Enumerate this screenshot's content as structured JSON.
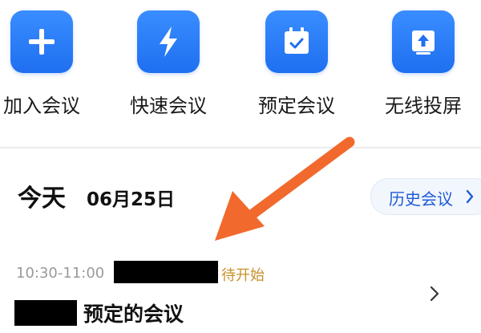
{
  "actions": [
    {
      "label": "加入会议",
      "icon": "plus-icon"
    },
    {
      "label": "快速会议",
      "icon": "lightning-icon"
    },
    {
      "label": "预定会议",
      "icon": "calendar-check-icon"
    },
    {
      "label": "无线投屏",
      "icon": "screen-cast-icon"
    }
  ],
  "schedule": {
    "today_label": "今天",
    "date": "06月25日",
    "history_button": "历史会议"
  },
  "meeting": {
    "time": "10:30-11:00",
    "status": "待开始",
    "title": "预定的会议"
  },
  "colors": {
    "accent": "#1f6ff0",
    "status": "#c8902a",
    "annotation_arrow": "#f2692e"
  }
}
